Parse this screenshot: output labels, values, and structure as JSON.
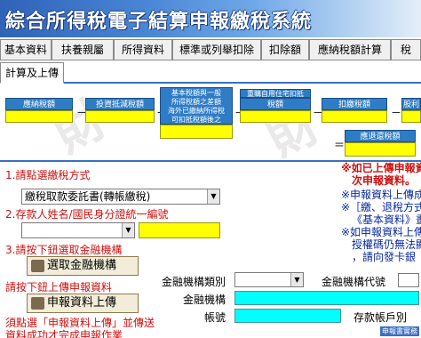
{
  "title": "綜合所得稅電子結算申報繳稅系統",
  "tabs_row1": [
    "基本資料",
    "扶養親屬",
    "所得資料",
    "標準或列舉扣除",
    "扣除額",
    "應納稅額計算",
    "稅"
  ],
  "tabs_row2": [
    "計算及上傳"
  ],
  "active_tab": "計算及上傳",
  "calc": {
    "labels": {
      "payable_tax": "應納稅額",
      "investment_credit": "投資抵減稅額",
      "big_box": [
        "基本稅額與一般",
        "所得稅額之差額",
        "海外已繳納所得稅",
        "可扣抵稅額後之",
        "餘額"
      ],
      "housing_loan": "重購自用住宅扣抵",
      "housing_loan2": "稅額",
      "withholding": "扣繳稅額",
      "dividend": "股利",
      "refund_tax": "應退還稅額"
    },
    "operators": [
      "－",
      "＋",
      "－",
      "－",
      "－",
      "＝"
    ],
    "watermark": "財"
  },
  "form": {
    "step1": "1.請點選繳稅方式",
    "payment_method": "繳稅取款委託書(轉帳繳稅)",
    "step2": "2.存款人姓名/國民身分證統一編號",
    "step3": "3.請按下鈕選取金融機構",
    "select_bank_button": "選取金融機構",
    "upload_hint": "請按下鈕上傳申報資料",
    "upload_button": "申報資料上傳",
    "bottom_note_1": "須點選「申報資料上傳」並傳送",
    "bottom_note_2": "資料成功才完成申報作業",
    "bank_type_label": "金融機構類別",
    "bank_code_label": "金融機構代號",
    "bank_label": "金融機構",
    "account_label": "帳號",
    "deposit_label": "存款帳戶別",
    "right_notes": [
      "※如已上傳申報資",
      "次申報資料。",
      "※申報資料上傳成",
      "※［繳、退稅方式",
      "《基本資料》畫",
      "※如申報資料上傳",
      "授權碼仍無法顯",
      "，請向發卡銀"
    ],
    "corner_text": "申報書實務"
  },
  "colors": {
    "label_blue": "#2e7cc5",
    "field_yellow": "#ffff00",
    "field_cyan": "#00ffff",
    "note_red": "#d01010"
  }
}
